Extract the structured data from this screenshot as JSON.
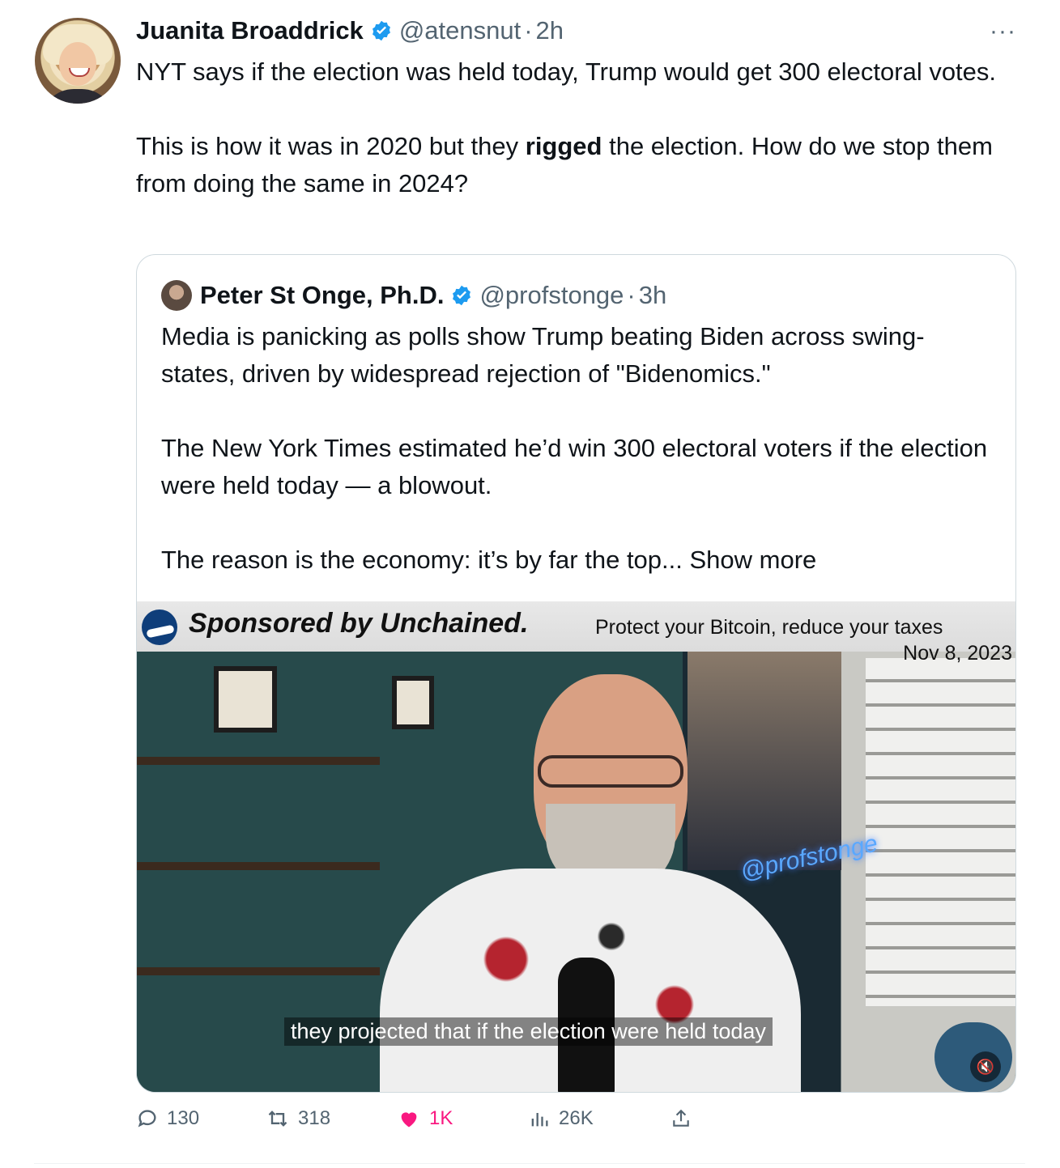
{
  "tweet": {
    "author": {
      "name": "Juanita Broaddrick",
      "handle": "@atensnut",
      "time": "2h"
    },
    "dot": "·",
    "more": "···",
    "text": {
      "p1": "NYT says if the election was held today, Trump would get 300 electoral votes.",
      "p2_before": "This is how it was in 2020 but they ",
      "p2_bold": "rigged",
      "p2_after": " the election.   How do we stop them from doing the same in 2024?"
    }
  },
  "quote": {
    "author": {
      "name": "Peter St Onge, Ph.D.",
      "handle": "@profstonge",
      "time": "3h"
    },
    "dot": "·",
    "text": {
      "p1": "Media is panicking as polls show Trump beating Biden across swing-states, driven by widespread rejection of \"Bidenomics.\"",
      "p2": "The New York Times estimated he’d win 300 electoral voters if the election were held today — a blowout.",
      "p3": "The reason is the economy: it’s by far the top... ",
      "show_more": "Show more"
    },
    "video": {
      "banner_sponsored": "Sponsored by Unchained.",
      "banner_protect": "Protect your Bitcoin, reduce your taxes",
      "banner_date": "Nov 8, 2023",
      "neon_sign": "@profstonge",
      "caption": "they projected that if the election were held today"
    }
  },
  "actions": {
    "replies": "130",
    "retweets": "318",
    "likes": "1K",
    "views": "26K"
  },
  "colors": {
    "text": "#0f1419",
    "muted": "#536471",
    "verified": "#1d9bf0",
    "like": "#f91880",
    "border": "#cfd9de"
  }
}
